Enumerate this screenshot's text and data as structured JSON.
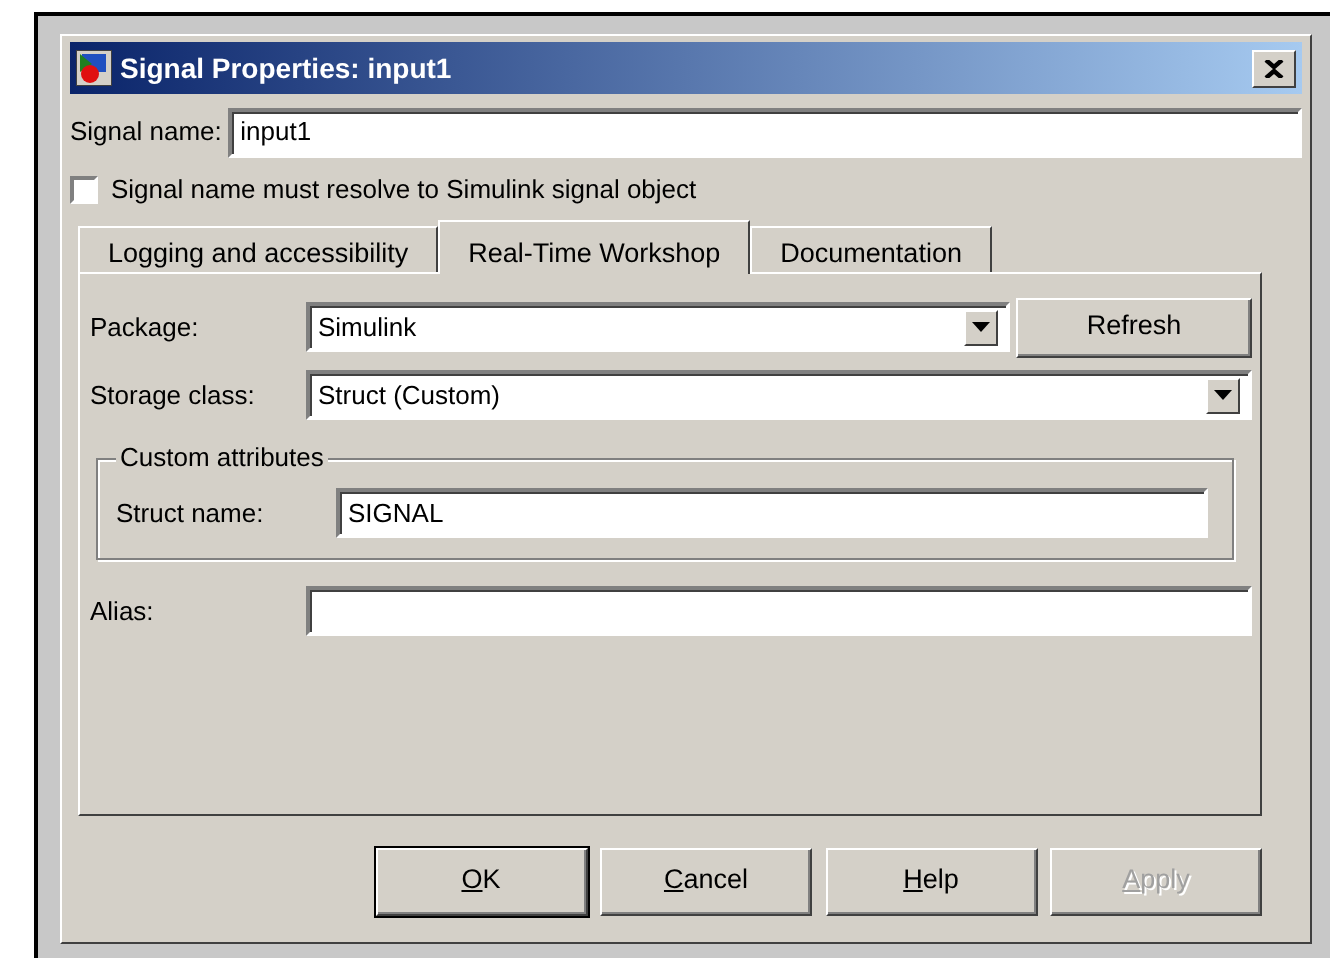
{
  "window": {
    "title": "Signal Properties: input1"
  },
  "signal_name": {
    "label": "Signal name:",
    "value": "input1"
  },
  "resolve_checkbox": {
    "label": "Signal name must resolve to Simulink signal object",
    "checked": false
  },
  "tabs": [
    {
      "label": "Logging and accessibility",
      "selected": false
    },
    {
      "label": "Real-Time Workshop",
      "selected": true
    },
    {
      "label": "Documentation",
      "selected": false
    }
  ],
  "package": {
    "label": "Package:",
    "value": "Simulink",
    "button": "Refresh"
  },
  "storage_class": {
    "label": "Storage class:",
    "value": "Struct (Custom)"
  },
  "custom_attributes": {
    "title": "Custom attributes",
    "struct_name": {
      "label": "Struct name:",
      "value": "SIGNAL"
    }
  },
  "alias": {
    "label": "Alias:"
  },
  "buttons": [
    {
      "label": "OK",
      "default": true,
      "disabled": false
    },
    {
      "label": "Cancel",
      "default": false,
      "disabled": false
    },
    {
      "label": "Help",
      "default": false,
      "disabled": false
    },
    {
      "label": "Apply",
      "default": false,
      "disabled": true
    }
  ]
}
